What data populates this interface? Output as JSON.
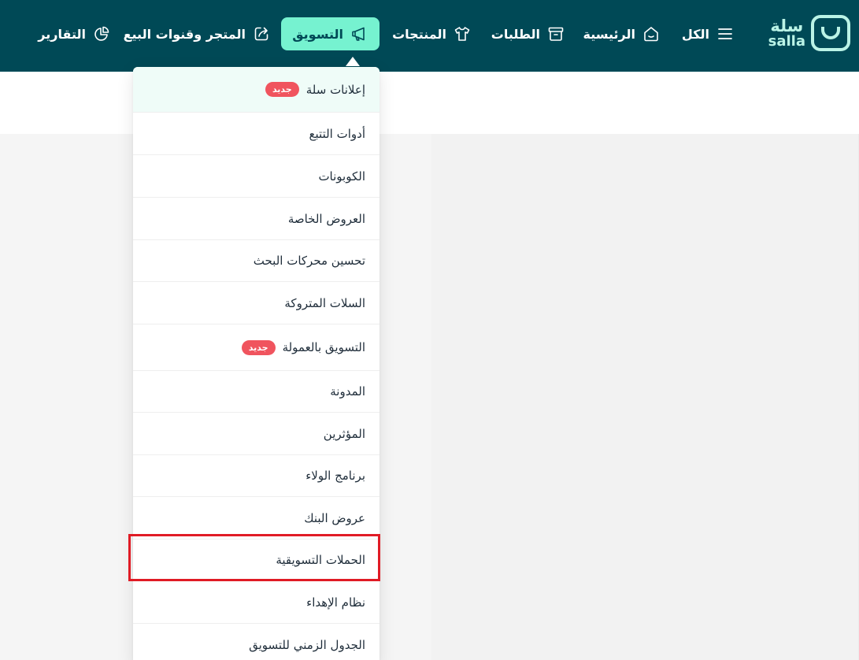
{
  "logo": {
    "arabic": "سلة",
    "latin": "salla"
  },
  "nav": {
    "all": "الكل",
    "home": "الرئيسية",
    "orders": "الطلبات",
    "products": "المنتجات",
    "marketing": "التسويق",
    "store_channels": "المتجر وقنوات البيع",
    "reports": "التقارير"
  },
  "colors": {
    "navbar": "#004956",
    "accent": "#76f2d0",
    "badge": "#f0545e",
    "highlight": "#e01b25"
  },
  "marketing_menu": {
    "items": [
      {
        "label": "إعلانات سلة",
        "badge": "جديد"
      },
      {
        "label": "أدوات التتبع"
      },
      {
        "label": "الكوبونات"
      },
      {
        "label": "العروض الخاصة"
      },
      {
        "label": "تحسين محركات البحث"
      },
      {
        "label": "السلات المتروكة"
      },
      {
        "label": "التسويق بالعمولة",
        "badge": "جديد"
      },
      {
        "label": "المدونة"
      },
      {
        "label": "المؤثرين"
      },
      {
        "label": "برنامج الولاء"
      },
      {
        "label": "عروض البنك"
      },
      {
        "label": "الحملات التسويقية"
      },
      {
        "label": "نظام الإهداء"
      },
      {
        "label": "الجدول الزمني للتسويق"
      }
    ]
  }
}
